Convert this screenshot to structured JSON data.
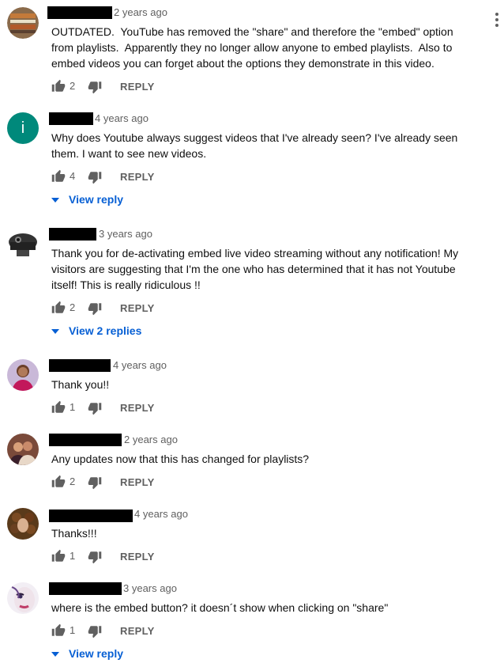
{
  "colors": {
    "link": "#065fd4",
    "muted": "#606060",
    "text": "#0f0f0f"
  },
  "reply_label": "REPLY",
  "comments": [
    {
      "time": "2 years ago",
      "text": "OUTDATED.  YouTube has removed the \"share\" and therefore the \"embed\" option from playlists.  Apparently they no longer allow anyone to embed playlists.  Also to embed videos you can forget about the options they demonstrate in this video.",
      "likes": "2",
      "avatar": "ornate-logo-avatar"
    },
    {
      "time": "4 years ago",
      "text": "Why does Youtube always suggest videos that I've already seen? I've already seen them. I want to see new videos.",
      "likes": "4",
      "avatar_letter": "i",
      "view_replies": "View reply"
    },
    {
      "time": "3 years ago",
      "text": "Thank you for de-activating embed live video streaming without any notification! My visitors are suggesting that I'm the one who has determined that it has not Youtube itself! This is really ridiculous !!",
      "likes": "2",
      "avatar": "dome-camera-avatar",
      "view_replies": "View 2 replies"
    },
    {
      "time": "4 years ago",
      "text": "Thank you!!",
      "likes": "1",
      "avatar": "person-photo-avatar"
    },
    {
      "time": "2 years ago",
      "text": "Any updates now that this has changed for playlists?",
      "likes": "2",
      "avatar": "couple-photo-avatar"
    },
    {
      "time": "4 years ago",
      "text": "Thanks!!!",
      "likes": "1",
      "avatar": "curly-hair-photo-avatar"
    },
    {
      "time": "3 years ago",
      "text": "where is the embed button? it doesn´t show when clicking on \"share\"",
      "likes": "1",
      "avatar": "face-art-avatar",
      "view_replies": "View reply"
    }
  ]
}
